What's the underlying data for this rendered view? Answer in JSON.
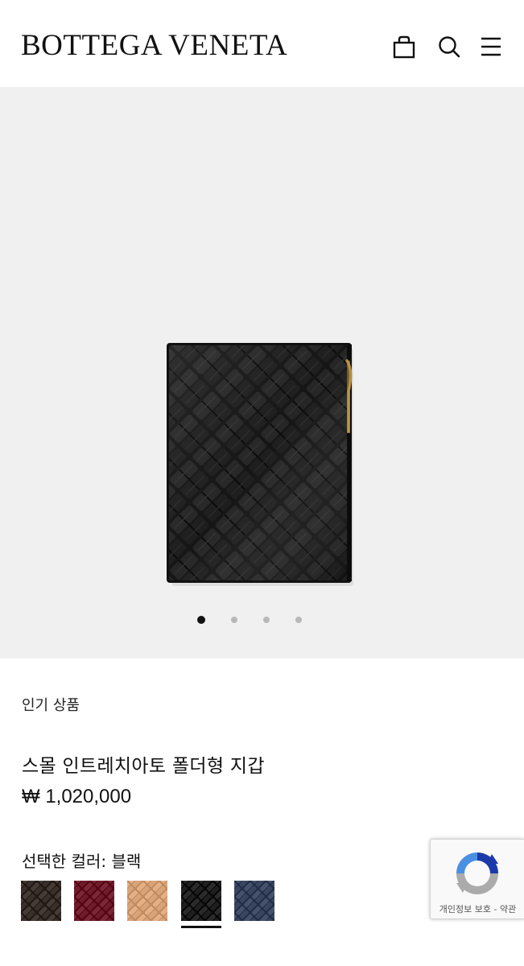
{
  "header": {
    "brand": "BOTTEGA VENETA",
    "icons": [
      "shopping-bag-icon",
      "search-icon",
      "menu-icon"
    ]
  },
  "gallery": {
    "image_count": 4,
    "active_index": 0,
    "background": "#f0f0f0"
  },
  "product": {
    "badge": "인기 상품",
    "name": "스몰 인트레치아토 폴더형 지갑",
    "price": "₩ 1,020,000",
    "color_label": "선택한 컬러: 블랙",
    "swatches": [
      {
        "name": "dark-brown",
        "color": "#3a302b"
      },
      {
        "name": "burgundy",
        "color": "#6e1c2b"
      },
      {
        "name": "camel",
        "color": "#d9a47a"
      },
      {
        "name": "black",
        "color": "#1f1f1f"
      },
      {
        "name": "navy",
        "color": "#3a4560"
      }
    ],
    "selected_swatch": 3
  },
  "recaptcha": {
    "privacy": "개인정보 보호",
    "separator": " - ",
    "terms": "약관"
  }
}
